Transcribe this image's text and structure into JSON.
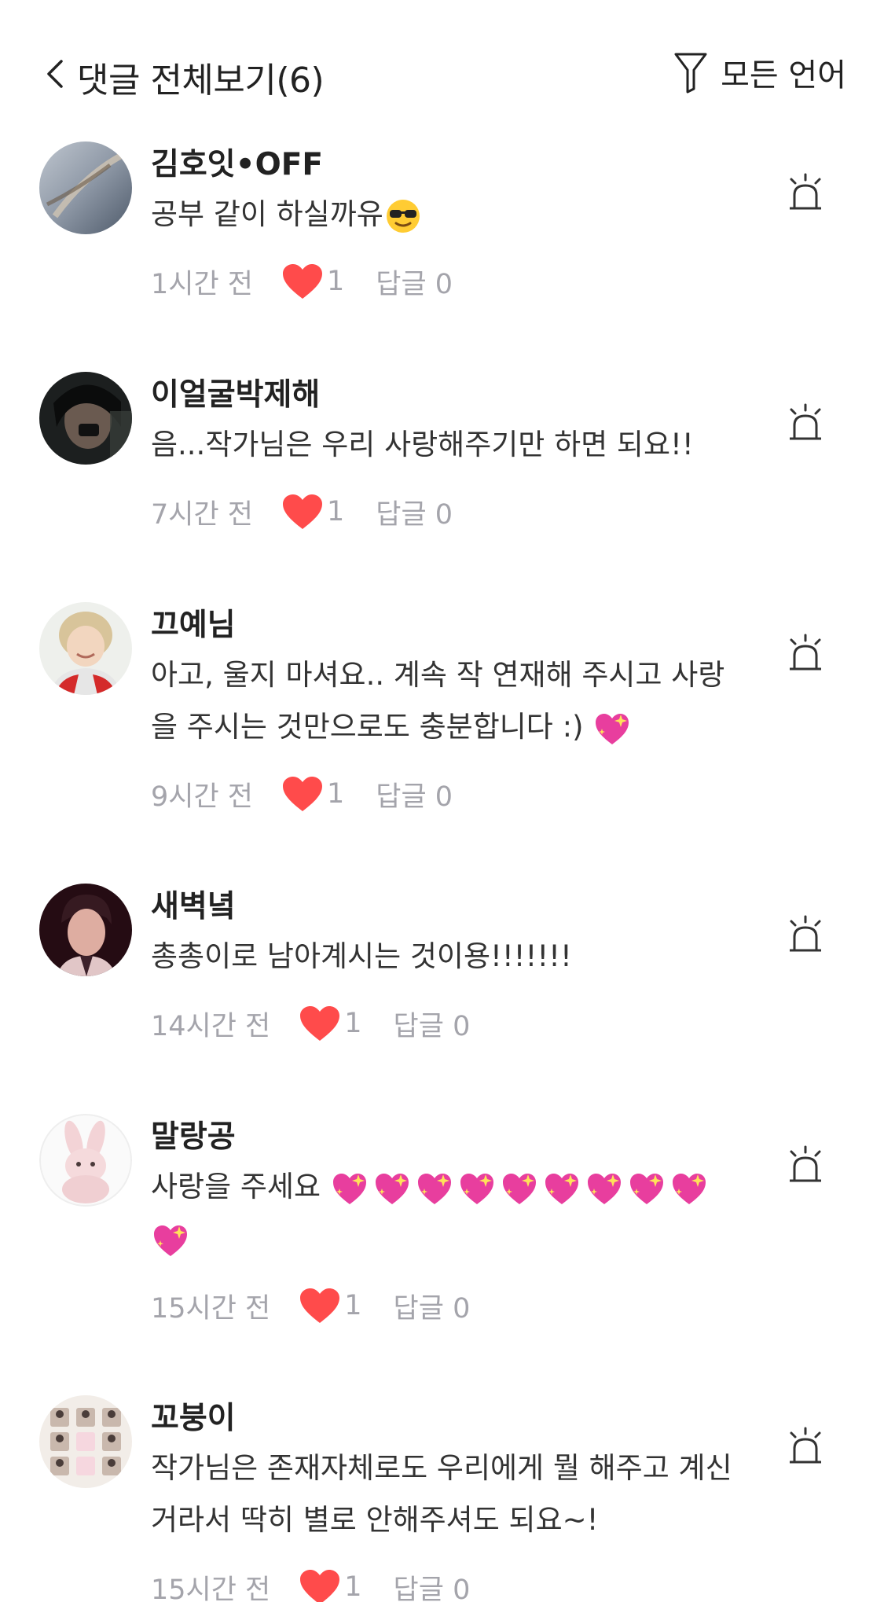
{
  "header": {
    "title": "댓글 전체보기(6)",
    "filter_label": "모든 언어"
  },
  "colors": {
    "heart": "#ff4b4b",
    "meta_text": "#a4a4ab",
    "emoji_heart": "#e83e9e"
  },
  "comments": [
    {
      "username": "김호잇•OFF",
      "text": "공부 같이 하실까유",
      "emoji": "sunglasses-face",
      "time": "1시간 전",
      "likes": "1",
      "reply_label": "답글 0"
    },
    {
      "username": "이얼굴박제해",
      "text": "음...작가님은 우리 사랑해주기만 하면 되요!!",
      "time": "7시간 전",
      "likes": "1",
      "reply_label": "답글 0"
    },
    {
      "username": "끄예님",
      "text": "아고, 울지 마셔요.. 계속 작 연재해 주시고 사랑을 주시는 것만으로도 충분합니다 :)",
      "emoji": "sparkling-heart",
      "time": "9시간 전",
      "likes": "1",
      "reply_label": "답글 0"
    },
    {
      "username": "새벽녘",
      "text": "총총이로 남아계시는 것이용!!!!!!!",
      "time": "14시간 전",
      "likes": "1",
      "reply_label": "답글 0"
    },
    {
      "username": "말랑공",
      "text": "사랑을 주세요",
      "emoji": "sparkling-heart",
      "emoji_count": 10,
      "time": "15시간 전",
      "likes": "1",
      "reply_label": "답글 0"
    },
    {
      "username": "꼬붕이",
      "text": "작가님은 존재자체로도 우리에게 뭘 해주고 계신거라서 딱히 별로 안해주셔도 되요~!",
      "time": "15시간 전",
      "likes": "1",
      "reply_label": "답글 0"
    }
  ]
}
